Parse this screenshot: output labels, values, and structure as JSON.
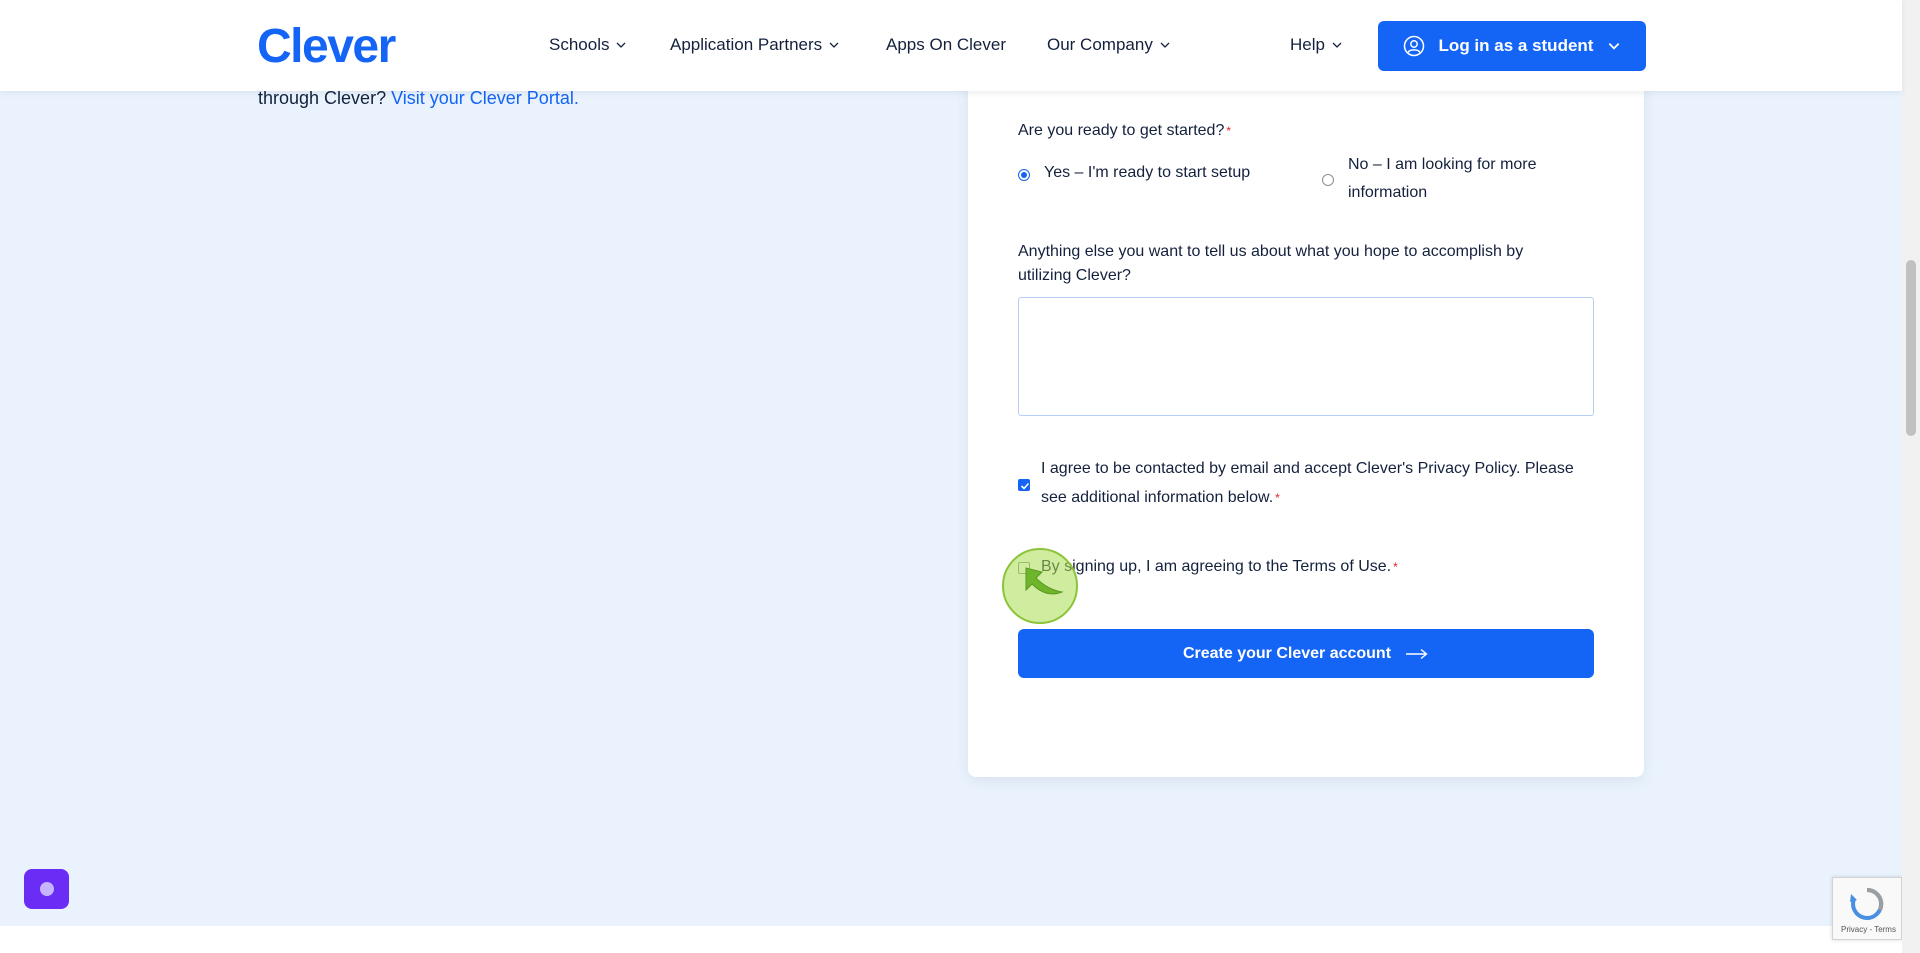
{
  "header": {
    "logo": "Clever",
    "nav": [
      {
        "label": "Schools",
        "dropdown": true
      },
      {
        "label": "Application Partners",
        "dropdown": true
      },
      {
        "label": "Apps On Clever",
        "dropdown": false
      },
      {
        "label": "Our Company",
        "dropdown": true
      },
      {
        "label": "Help",
        "dropdown": true
      }
    ],
    "login_button": "Log in as a student",
    "login_icon": "user-circle-icon"
  },
  "left": {
    "text": "through Clever?",
    "link": "Visit your Clever Portal."
  },
  "form": {
    "ready_question": "Are you ready to get started?",
    "required_mark": "*",
    "options": [
      {
        "label": "Yes – I'm ready to start setup",
        "selected": true
      },
      {
        "label_line1": "No – I am looking for more",
        "label_line2": "information",
        "selected": false
      }
    ],
    "anything_question_line1": "Anything else you want to tell us about what you hope to accomplish by",
    "anything_question_line2": "utilizing Clever?",
    "textarea_value": "",
    "consent_line1": "I agree to be contacted by email and accept Clever's Privacy Policy. Please",
    "consent_line2": "see additional information below.",
    "consent_checked": true,
    "terms_label": "By signing up, I am agreeing to the Terms of Use.",
    "terms_checked": false,
    "submit_label": "Create your Clever account",
    "submit_icon": "arrow-right-icon"
  },
  "recaptcha": {
    "links": "Privacy - Terms"
  },
  "colors": {
    "brand": "#1464f6",
    "background": "#eaf3fd",
    "chat": "#6b2cf5"
  }
}
